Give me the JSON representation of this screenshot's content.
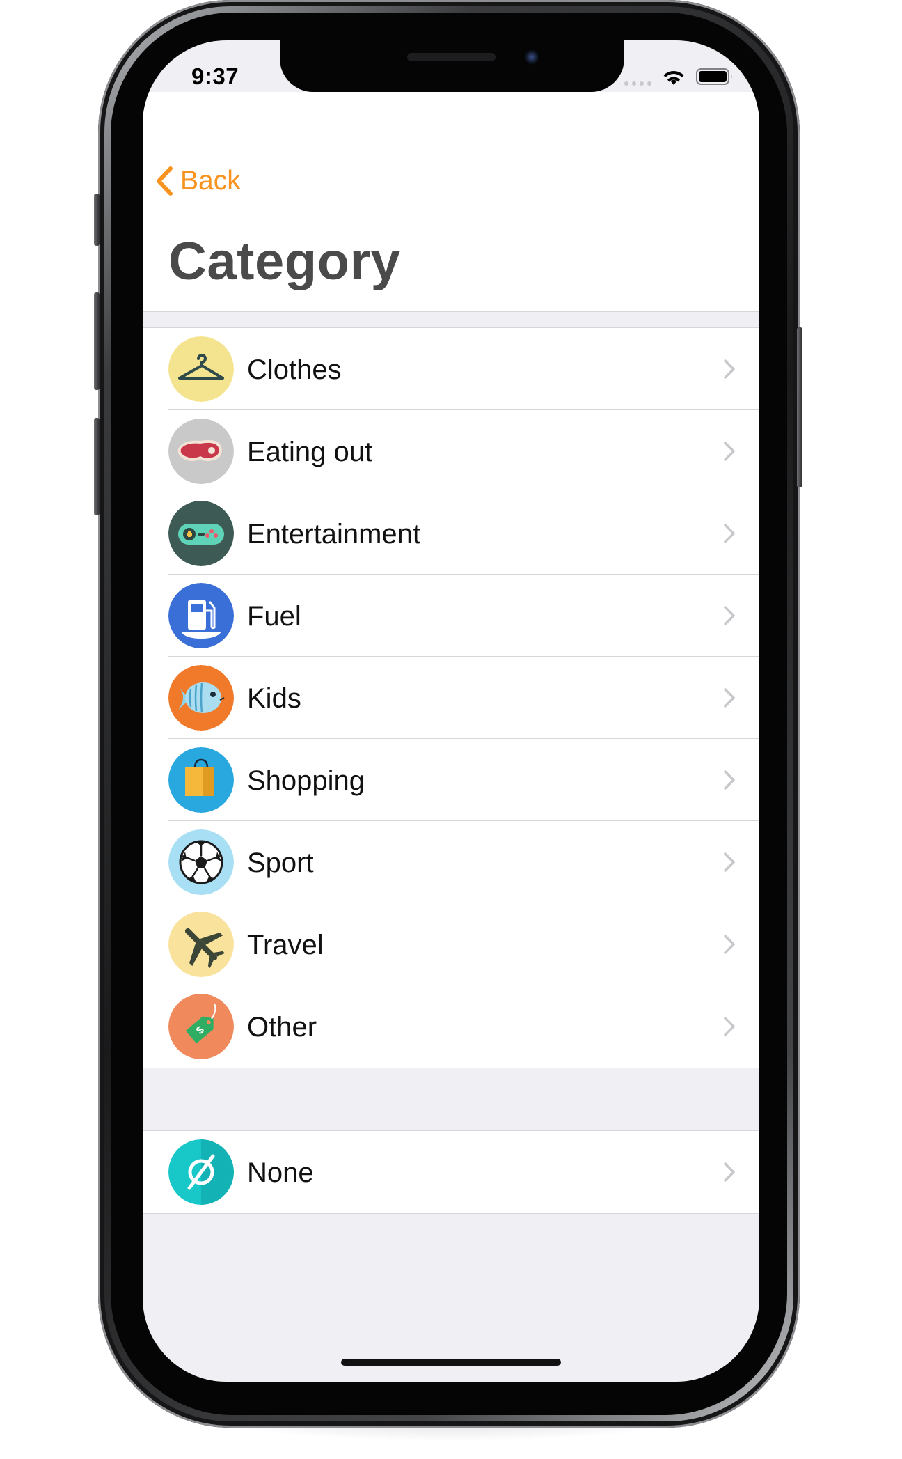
{
  "status_bar": {
    "time": "9:37"
  },
  "nav": {
    "back_label": "Back",
    "title": "Category"
  },
  "categories": [
    {
      "label": "Clothes",
      "icon": "hanger-icon",
      "color": "#f5e48f"
    },
    {
      "label": "Eating out",
      "icon": "steak-icon",
      "color": "#c9c9c9"
    },
    {
      "label": "Entertainment",
      "icon": "gamepad-icon",
      "color": "#3d5a55"
    },
    {
      "label": "Fuel",
      "icon": "fuel-pump-icon",
      "color": "#3b6fd8"
    },
    {
      "label": "Kids",
      "icon": "fish-icon",
      "color": "#f07a2a"
    },
    {
      "label": "Shopping",
      "icon": "shopping-bag-icon",
      "color": "#29a8df"
    },
    {
      "label": "Sport",
      "icon": "soccer-ball-icon",
      "color": "#a8dff4"
    },
    {
      "label": "Travel",
      "icon": "airplane-icon",
      "color": "#f9e29c"
    },
    {
      "label": "Other",
      "icon": "price-tag-icon",
      "color": "#f08a5d"
    }
  ],
  "none_item": {
    "label": "None",
    "icon": "empty-set-icon",
    "color": "#18c8c8"
  },
  "colors": {
    "accent": "#f7931e",
    "background": "#efeff4",
    "separator": "#d5d5da"
  }
}
